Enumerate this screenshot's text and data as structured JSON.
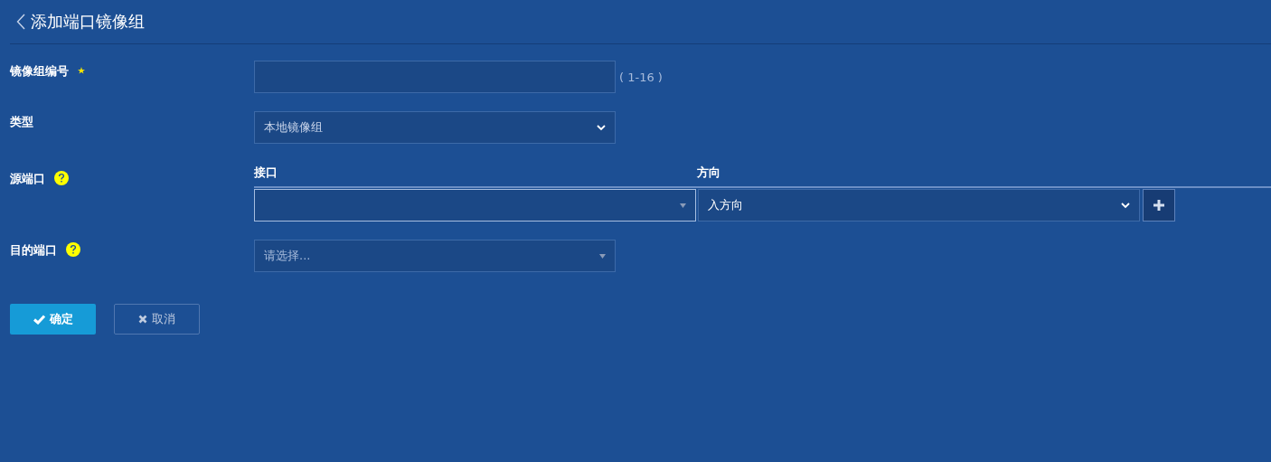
{
  "header": {
    "title": "添加端口镜像组"
  },
  "fields": [
    {
      "kind": "text",
      "label": "镜像组编号",
      "required": true,
      "help": false,
      "hint": "( 1-16 )"
    },
    {
      "kind": "select",
      "label": "类型",
      "required": false,
      "help": false,
      "value": "本地镜像组"
    },
    {
      "kind": "table",
      "label": "源端口",
      "required": false,
      "help": true,
      "columns": [
        "接口",
        "方向"
      ],
      "rows": [
        {
          "interface": "",
          "direction": "入方向"
        }
      ]
    },
    {
      "kind": "combo",
      "label": "目的端口",
      "required": false,
      "help": true,
      "placeholder": "请选择..."
    }
  ],
  "buttons": [
    {
      "label": "确定",
      "kind": "primary"
    },
    {
      "label": "取消",
      "kind": "cancel"
    }
  ]
}
